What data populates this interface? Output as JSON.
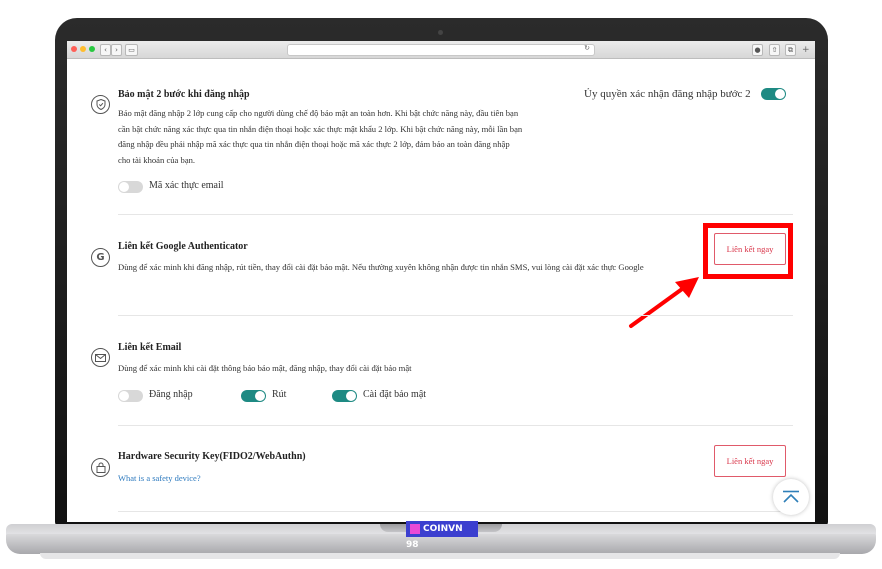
{
  "twofa": {
    "title": "Bảo mật 2 bước khi đăng nhập",
    "description": "Bảo mật đăng nhập 2 lớp cung cấp cho người dùng chế độ bảo mật an toàn hơn. Khi bật chức năng này, đầu tiên bạn cần bật chức năng xác thực qua tin nhắn điện thoại hoặc xác thực mật khẩu 2 lớp. Khi bật chức năng này, mỗi lần bạn đăng nhập đều phải nhập mã xác thực qua tin nhắn điện thoại hoặc mã xác thực 2 lớp, đảm bảo an toàn đăng nhập cho tài khoản của bạn.",
    "authorize_label": "Ủy quyền xác nhận đăng nhập bước 2",
    "authorize_on": true,
    "email_code_label": "Mã xác thực email",
    "email_code_on": false
  },
  "google_auth": {
    "title": "Liên kết Google Authenticator",
    "description": "Dùng để xác minh khi đăng nhập, rút tiền, thay đổi cài đặt bảo mật. Nếu thường xuyên không nhận được tin nhắn SMS, vui lòng cài đặt xác thực Google",
    "button_label": "Liên kết ngay"
  },
  "email_link": {
    "title": "Liên kết Email",
    "description": "Dùng để xác minh khi cài đặt thông báo bảo mật, đăng nhập, thay đổi cài đặt bảo mật",
    "toggles": [
      {
        "label": "Đăng nhập",
        "on": false
      },
      {
        "label": "Rút",
        "on": true
      },
      {
        "label": "Cài đặt bảo mật",
        "on": true
      }
    ]
  },
  "hardware_key": {
    "title": "Hardware Security Key(FIDO2/WebAuthn)",
    "link_label": "What is a safety device?",
    "button_label": "Liên kết ngay"
  },
  "watermark": {
    "text": "COINVN 98"
  },
  "colors": {
    "accent": "#1e8a83",
    "danger": "#d9364a",
    "highlight": "#ff0000",
    "link": "#2f7bbf"
  }
}
